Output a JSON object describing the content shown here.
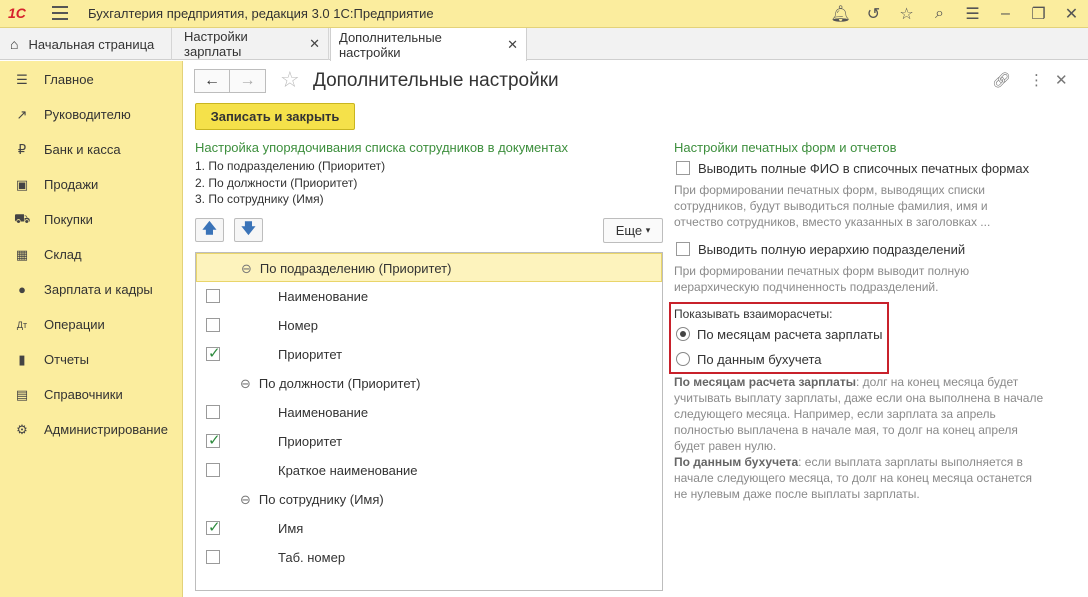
{
  "app": {
    "logo": "1С",
    "title": "Бухгалтерия предприятия, редакция 3.0 1С:Предприятие"
  },
  "tabs": [
    {
      "label": "Начальная страница"
    },
    {
      "label": "Настройки зарплаты",
      "close": "✕"
    },
    {
      "label": "Дополнительные настройки",
      "close": "✕"
    }
  ],
  "sidebar": {
    "items": [
      {
        "label": "Главное",
        "icon": "menu-icon"
      },
      {
        "label": "Руководителю",
        "icon": "trend-icon"
      },
      {
        "label": "Банк и касса",
        "icon": "ruble-icon"
      },
      {
        "label": "Продажи",
        "icon": "bag-icon"
      },
      {
        "label": "Покупки",
        "icon": "cart-icon"
      },
      {
        "label": "Склад",
        "icon": "warehouse-icon"
      },
      {
        "label": "Зарплата и кадры",
        "icon": "person-icon"
      },
      {
        "label": "Операции",
        "icon": "debit-credit-icon"
      },
      {
        "label": "Отчеты",
        "icon": "bar-chart-icon"
      },
      {
        "label": "Справочники",
        "icon": "book-icon"
      },
      {
        "label": "Администрирование",
        "icon": "gear-icon"
      }
    ]
  },
  "page": {
    "title": "Дополнительные настройки",
    "save_close": "Записать и закрыть",
    "more": "Еще"
  },
  "sorting": {
    "title": "Настройка упорядочивания списка сотрудников в документах",
    "lines": [
      "1. По подразделению (Приоритет)",
      "2. По должности (Приоритет)",
      "3. По сотруднику (Имя)"
    ],
    "tree": [
      {
        "type": "group",
        "label": "По подразделению (Приоритет)"
      },
      {
        "type": "item",
        "label": "Наименование",
        "checked": false
      },
      {
        "type": "item",
        "label": "Номер",
        "checked": false
      },
      {
        "type": "item",
        "label": "Приоритет",
        "checked": true
      },
      {
        "type": "group",
        "label": "По должности (Приоритет)"
      },
      {
        "type": "item",
        "label": "Наименование",
        "checked": false
      },
      {
        "type": "item",
        "label": "Приоритет",
        "checked": true
      },
      {
        "type": "item",
        "label": "Краткое наименование",
        "checked": false
      },
      {
        "type": "group",
        "label": "По сотруднику (Имя)"
      },
      {
        "type": "item",
        "label": "Имя",
        "checked": true
      },
      {
        "type": "item",
        "label": "Таб. номер",
        "checked": false
      }
    ]
  },
  "print": {
    "title": "Настройки печатных форм и отчетов",
    "fio_label": "Выводить полные ФИО в списочных печатных формах",
    "fio_desc": [
      "При формировании печатных форм, выводящих списки",
      "сотрудников, будут выводиться полные фамилия, имя и",
      "отчество сотрудников, вместо указанных в заголовках ..."
    ],
    "hier_label": "Выводить полную иерархию подразделений",
    "hier_desc": [
      "При формировании печатных форм выводит полную",
      "иерархическую подчиненность подразделений."
    ],
    "settlements_label": "Показывать взаиморасчеты:",
    "radio1": "По месяцам расчета зарплаты",
    "radio2": "По данным бухучета",
    "note1_bold": "По месяцам расчета зарплаты",
    "note1_lines": [
      ": долг на конец месяца будет",
      "учитывать выплату зарплаты, даже если она выполнена в начале",
      "следующего месяца. Например, если зарплата за апрель",
      "полностью выплачена в начале мая, то долг на конец апреля",
      "будет равен нулю."
    ],
    "note2_bold": "По данным бухучета",
    "note2_lines": [
      ": если выплата зарплаты выполняется в",
      "начале следующего месяца, то долг на конец месяца останется",
      "не нулевым даже после выплаты зарплаты."
    ]
  }
}
